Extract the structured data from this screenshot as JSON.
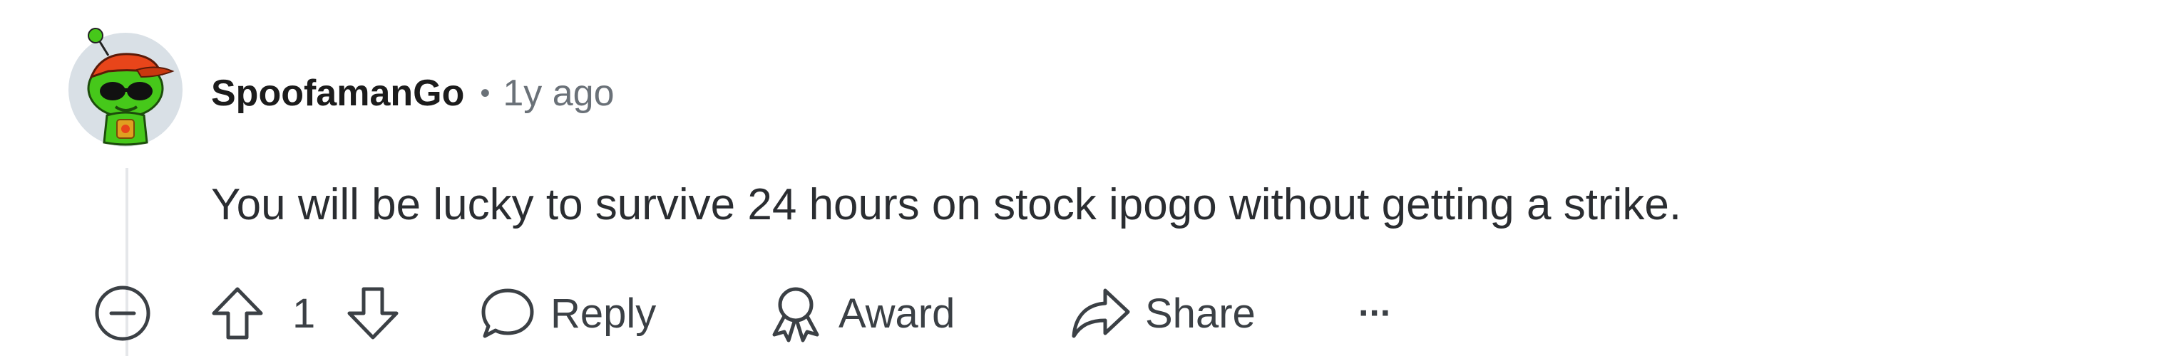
{
  "comment": {
    "author": "SpoofamanGo",
    "separator": "•",
    "timestamp": "1y ago",
    "text": "You will be lucky to survive 24 hours on stock ipogo without getting a strike."
  },
  "actions": {
    "vote_count": "1",
    "reply_label": "Reply",
    "award_label": "Award",
    "share_label": "Share",
    "more_label": "···"
  },
  "icons": {
    "collapse": "minus-circle-icon",
    "upvote": "arrow-up-outline-icon",
    "downvote": "arrow-down-outline-icon",
    "reply": "speech-bubble-icon",
    "award": "award-ribbon-icon",
    "share": "share-arrow-icon",
    "more": "ellipsis-icon"
  },
  "colors": {
    "text_primary": "#1c1c1c",
    "text_muted": "#6a7178",
    "icon": "#3b4045",
    "thread_line": "#e5e7ea",
    "avatar_bg": "#d9e0e6",
    "avatar_green": "#46c81a",
    "avatar_cap": "#e8451a"
  }
}
